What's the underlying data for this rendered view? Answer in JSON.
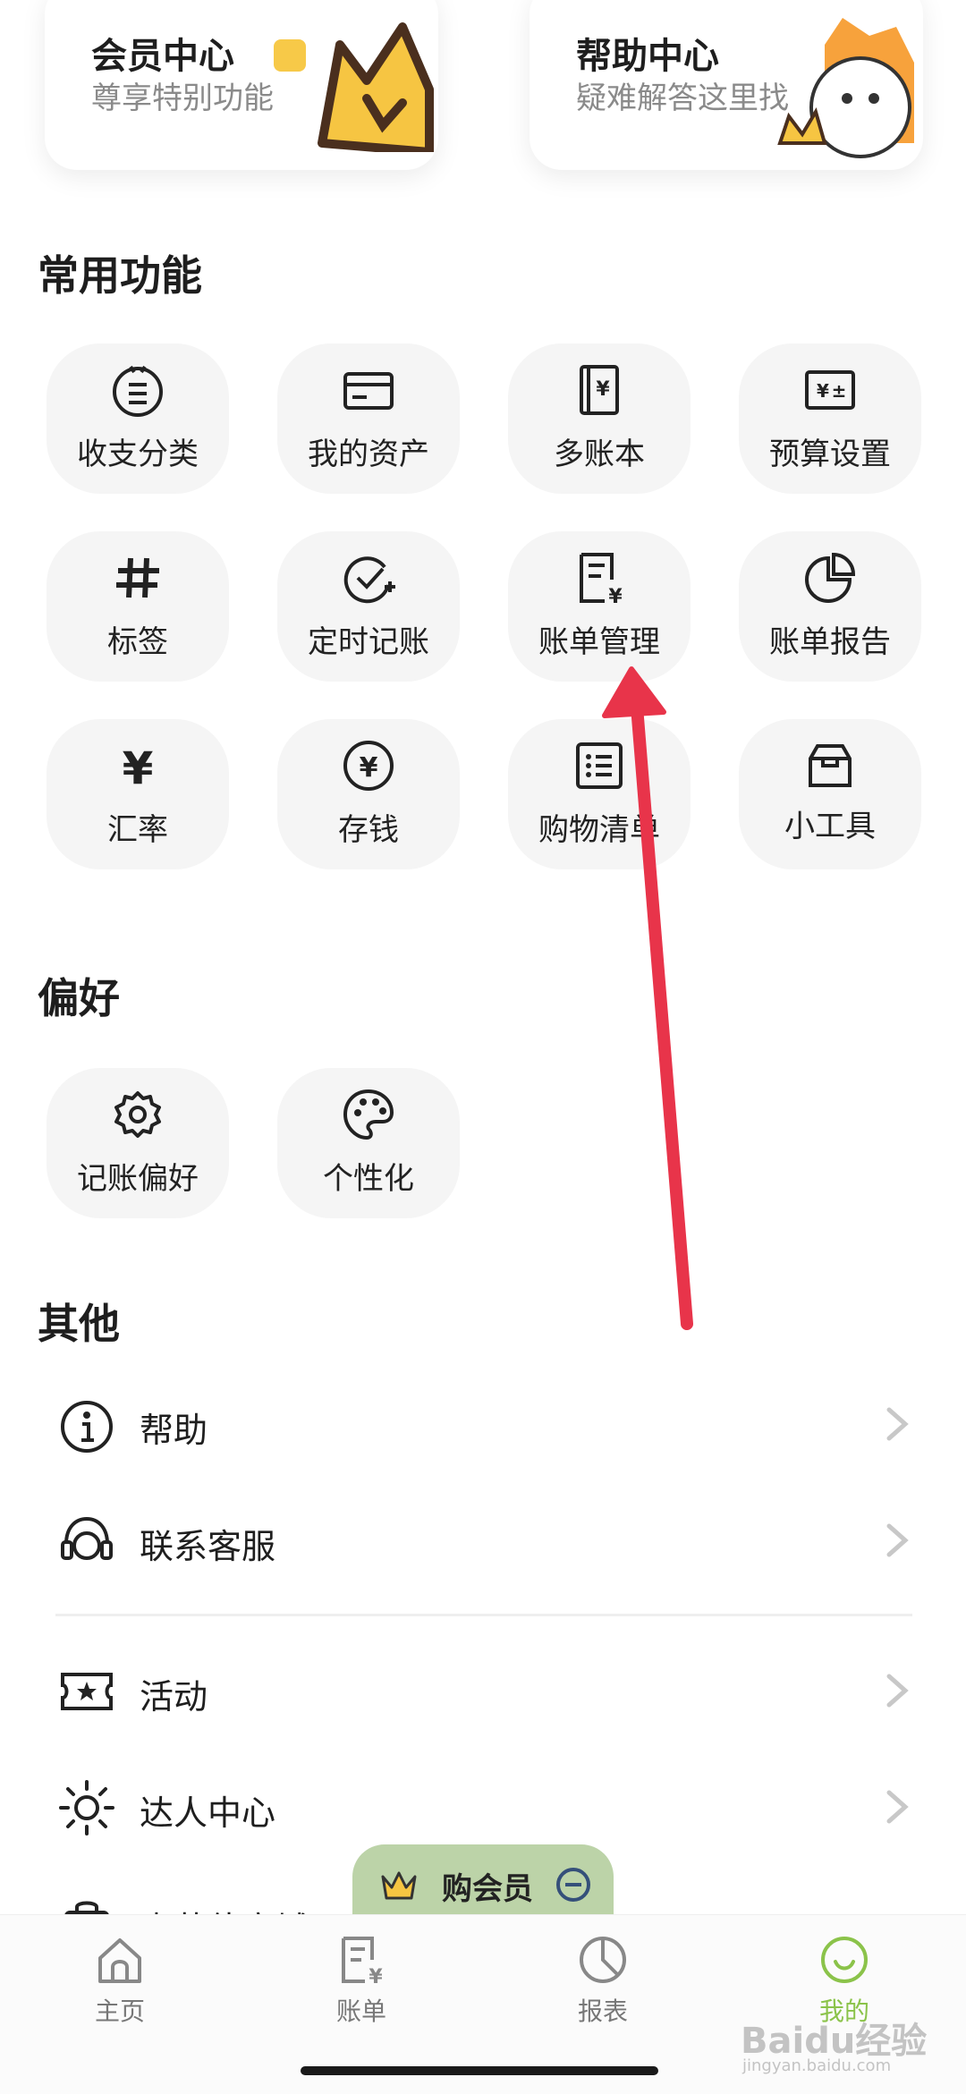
{
  "top_cards": {
    "vip": {
      "title": "会员中心",
      "subtitle": "尊享特别功能"
    },
    "help": {
      "title": "帮助中心",
      "subtitle": "疑难解答这里找"
    }
  },
  "common": {
    "title": "常用功能",
    "items": [
      {
        "label": "收支分类",
        "icon": "category-icon"
      },
      {
        "label": "我的资产",
        "icon": "card-icon"
      },
      {
        "label": "多账本",
        "icon": "ledger-book-icon"
      },
      {
        "label": "预算设置",
        "icon": "budget-icon"
      },
      {
        "label": "标签",
        "icon": "hashtag-icon"
      },
      {
        "label": "定时记账",
        "icon": "scheduled-check-icon"
      },
      {
        "label": "账单管理",
        "icon": "bill-manage-icon"
      },
      {
        "label": "账单报告",
        "icon": "pie-report-icon"
      },
      {
        "label": "汇率",
        "icon": "yen-icon"
      },
      {
        "label": "存钱",
        "icon": "coin-icon"
      },
      {
        "label": "购物清单",
        "icon": "list-icon"
      },
      {
        "label": "小工具",
        "icon": "toolbox-icon"
      }
    ]
  },
  "preferences": {
    "title": "偏好",
    "items": [
      {
        "label": "记账偏好",
        "icon": "gear-icon"
      },
      {
        "label": "个性化",
        "icon": "palette-icon"
      }
    ]
  },
  "other": {
    "title": "其他",
    "items": [
      {
        "label": "帮助",
        "icon": "info-icon"
      },
      {
        "label": "联系客服",
        "icon": "headset-icon"
      },
      {
        "label": "活动",
        "icon": "ticket-star-icon"
      },
      {
        "label": "达人中心",
        "icon": "sun-icon"
      },
      {
        "label": "麦芽佳商城",
        "icon": "bag-icon"
      }
    ]
  },
  "vip_button": {
    "label": "购会员"
  },
  "tabs": [
    {
      "label": "主页",
      "icon": "home-icon"
    },
    {
      "label": "账单",
      "icon": "bill-icon"
    },
    {
      "label": "报表",
      "icon": "chart-icon"
    },
    {
      "label": "我的",
      "icon": "smile-icon"
    }
  ],
  "watermark": {
    "text": "Baidu经验",
    "url": "jingyan.baidu.com"
  },
  "colors": {
    "accent": "#8bc34a",
    "arrow": "#e8344a",
    "tile_bg": "#f5f5f5",
    "vip_pill": "#bcd3a8"
  }
}
